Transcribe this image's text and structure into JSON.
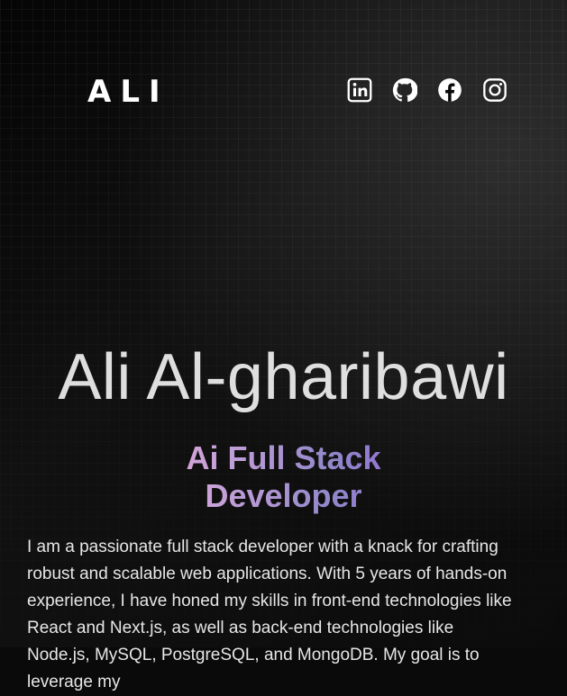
{
  "header": {
    "logo": "ALI",
    "socials": [
      {
        "name": "LinkedIn",
        "icon": "linkedin-icon"
      },
      {
        "name": "GitHub",
        "icon": "github-icon"
      },
      {
        "name": "Facebook",
        "icon": "facebook-icon"
      },
      {
        "name": "Instagram",
        "icon": "instagram-icon"
      }
    ]
  },
  "hero": {
    "name": "Ali Al-gharibawi",
    "role": "Ai Full Stack Developer",
    "bio": "I am a passionate full stack developer with a knack for crafting robust and scalable web applications. With 5 years of hands-on experience, I have honed my skills in front-end technologies like React and Next.js, as well as back-end technologies like Node.js, MySQL, PostgreSQL, and MongoDB. My goal is to leverage my"
  },
  "colors": {
    "background": "#0a0a0a",
    "text": "#e6e6e6",
    "gradient_start": "#f2a6cf",
    "gradient_end": "#a15ae8"
  }
}
